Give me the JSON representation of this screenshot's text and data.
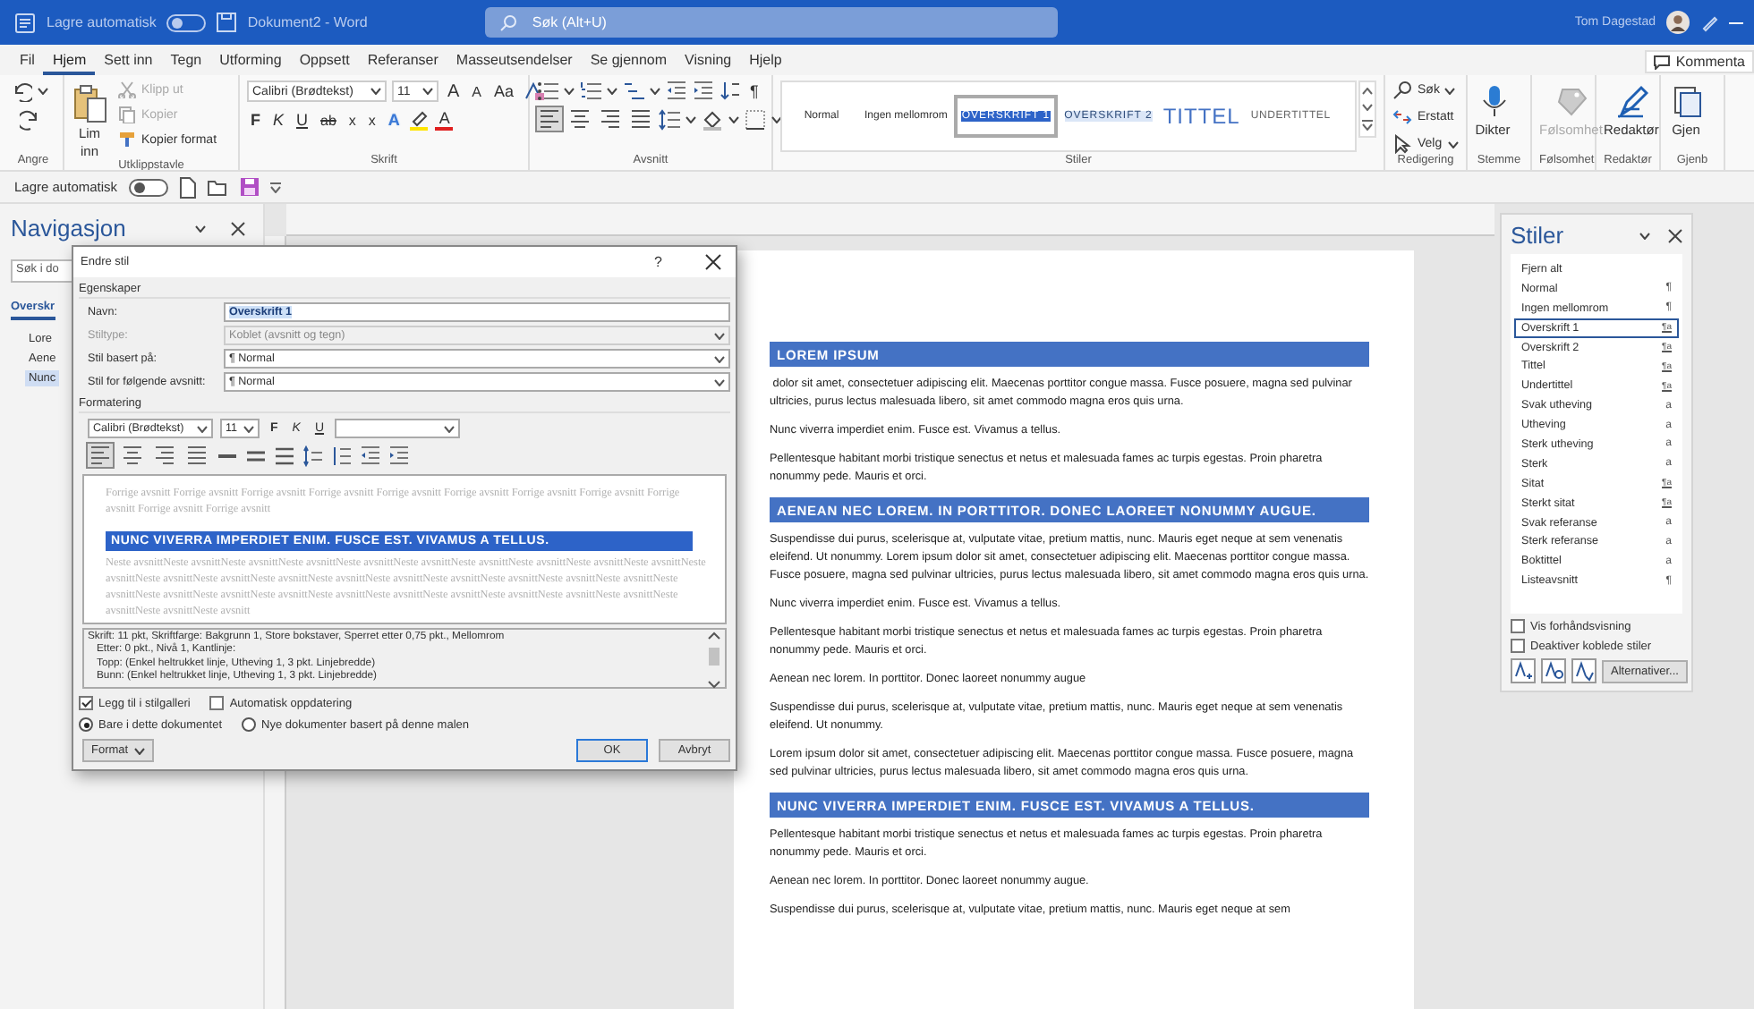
{
  "titlebar": {
    "autosave_label": "Lagre automatisk",
    "autosave_on": false,
    "document_title": "Dokument2  -  Word",
    "search_placeholder": "Søk (Alt+U)",
    "user_name": "Tom Dagestad"
  },
  "menu_tabs": [
    {
      "label": "Fil",
      "selected": false
    },
    {
      "label": "Hjem",
      "selected": true
    },
    {
      "label": "Sett inn",
      "selected": false
    },
    {
      "label": "Tegn",
      "selected": false
    },
    {
      "label": "Utforming",
      "selected": false
    },
    {
      "label": "Oppsett",
      "selected": false
    },
    {
      "label": "Referanser",
      "selected": false
    },
    {
      "label": "Masseutsendelser",
      "selected": false
    },
    {
      "label": "Se gjennom",
      "selected": false
    },
    {
      "label": "Visning",
      "selected": false
    },
    {
      "label": "Hjelp",
      "selected": false
    }
  ],
  "comments_button": "Kommenta",
  "ribbon": {
    "groups": [
      {
        "kind": "undo",
        "label": "Angre"
      },
      {
        "kind": "clipboard",
        "label": "Utklippstavle",
        "paste": [
          "Lim",
          "inn"
        ],
        "items": [
          {
            "label": "Klipp ut",
            "disabled": true
          },
          {
            "label": "Kopier",
            "disabled": true
          },
          {
            "label": "Kopier format",
            "disabled": false
          }
        ]
      },
      {
        "kind": "font",
        "label": "Skrift",
        "font": "Calibri (Brødtekst)",
        "size": "11",
        "row1": [
          {
            "label": "A",
            "kind": "grow"
          },
          {
            "label": "A",
            "kind": "shrink"
          },
          {
            "label": "Aa",
            "kind": "case"
          }
        ],
        "row2": [
          {
            "label": "F",
            "kind": "bold"
          },
          {
            "label": "K",
            "kind": "italic"
          },
          {
            "label": "U",
            "kind": "underline"
          },
          {
            "label": "ab",
            "kind": "strike"
          },
          {
            "label": "x",
            "kind": "sub"
          },
          {
            "label": "x",
            "kind": "sup"
          },
          {
            "label": "A",
            "kind": "effects"
          },
          {
            "label": "A",
            "kind": "color"
          }
        ]
      },
      {
        "kind": "paragraph",
        "label": "Avsnitt",
        "marks": "¶",
        "align": [
          {
            "selected": true
          },
          {
            "selected": false
          },
          {
            "selected": false
          },
          {
            "selected": false
          }
        ]
      },
      {
        "kind": "styles",
        "label": "Stiler",
        "items": [
          {
            "label": "Normal",
            "kind": "normal",
            "selected": false
          },
          {
            "label": "Ingen mellomrom",
            "kind": "nospacing",
            "selected": false
          },
          {
            "label": "OVERSKRIFT 1",
            "kind": "heading1",
            "selected": true
          },
          {
            "label": "OVERSKRIFT 2",
            "kind": "heading2",
            "selected": false
          },
          {
            "label": "TITTEL",
            "kind": "title",
            "selected": false
          },
          {
            "label": "UNDERTITTEL",
            "kind": "subtitle",
            "selected": false
          }
        ]
      },
      {
        "kind": "editing",
        "label": "Redigering",
        "items": [
          "Søk",
          "Erstatt",
          "Velg"
        ]
      },
      {
        "kind": "big",
        "label": "Stemme",
        "button": "Dikter",
        "disabled": false
      },
      {
        "kind": "big",
        "label": "Følsomhet",
        "button": "Følsomhet",
        "disabled": true
      },
      {
        "kind": "big",
        "label": "Redaktør",
        "button": "Redaktør",
        "disabled": false
      },
      {
        "kind": "big",
        "label": "Gjenb",
        "button": "Gjen",
        "disabled": false
      }
    ]
  },
  "quick_access": {
    "autosave_label": "Lagre automatisk",
    "autosave_on": false
  },
  "navigation": {
    "title": "Navigasjon",
    "search": "Søk i do",
    "tab": "Overskr",
    "items": [
      {
        "label": "Lore",
        "selected": false
      },
      {
        "label": "Aene",
        "selected": false
      },
      {
        "label": "Nunc",
        "selected": true
      }
    ]
  },
  "document": {
    "paragraphs": [
      {
        "kind": "heading",
        "text": "LOREM IPSUM"
      },
      {
        "kind": "body",
        "text": " dolor sit amet, consectetuer adipiscing elit. Maecenas porttitor congue massa. Fusce posuere, magna sed pulvinar ultricies, purus lectus malesuada libero, sit amet commodo magna eros quis urna."
      },
      {
        "kind": "body",
        "text": "Nunc viverra imperdiet enim. Fusce est. Vivamus a tellus."
      },
      {
        "kind": "body",
        "text": "Pellentesque habitant morbi tristique senectus et netus et malesuada fames ac turpis egestas. Proin pharetra nonummy pede. Mauris et orci."
      },
      {
        "kind": "heading",
        "text": "AENEAN NEC LOREM. IN PORTTITOR. DONEC LAOREET NONUMMY AUGUE."
      },
      {
        "kind": "body",
        "text": "Suspendisse dui purus, scelerisque at, vulputate vitae, pretium mattis, nunc. Mauris eget neque at sem venenatis eleifend. Ut nonummy. Lorem ipsum dolor sit amet, consectetuer adipiscing elit. Maecenas porttitor congue massa. Fusce posuere, magna sed pulvinar ultricies, purus lectus malesuada libero, sit amet commodo magna eros quis urna."
      },
      {
        "kind": "body",
        "text": "Nunc viverra imperdiet enim. Fusce est. Vivamus a tellus."
      },
      {
        "kind": "body",
        "text": "Pellentesque habitant morbi tristique senectus et netus et malesuada fames ac turpis egestas. Proin pharetra nonummy pede. Mauris et orci."
      },
      {
        "kind": "body",
        "text": "Aenean nec lorem. In porttitor. Donec laoreet nonummy augue"
      },
      {
        "kind": "body",
        "text": "Suspendisse dui purus, scelerisque at, vulputate vitae, pretium mattis, nunc. Mauris eget neque at sem venenatis eleifend. Ut nonummy."
      },
      {
        "kind": "body",
        "text": "Lorem ipsum dolor sit amet, consectetuer adipiscing elit. Maecenas porttitor congue massa. Fusce posuere, magna sed pulvinar ultricies, purus lectus malesuada libero, sit amet commodo magna eros quis urna."
      },
      {
        "kind": "heading",
        "text": "NUNC VIVERRA IMPERDIET ENIM. FUSCE EST. VIVAMUS A TELLUS."
      },
      {
        "kind": "body",
        "text": "Pellentesque habitant morbi tristique senectus et netus et malesuada fames ac turpis egestas. Proin pharetra nonummy pede. Mauris et orci."
      },
      {
        "kind": "body",
        "text": "Aenean nec lorem. In porttitor. Donec laoreet nonummy augue."
      },
      {
        "kind": "body",
        "text": "Suspendisse dui purus, scelerisque at, vulputate vitae, pretium mattis, nunc. Mauris eget neque at sem"
      }
    ]
  },
  "styles_pane": {
    "title": "Stiler",
    "items": [
      {
        "label": "Fjern alt",
        "marker": null,
        "selected": false
      },
      {
        "label": "Normal",
        "marker": "¶",
        "selected": false
      },
      {
        "label": "Ingen mellomrom",
        "marker": "¶",
        "selected": false
      },
      {
        "label": "Overskrift 1",
        "marker": "¶a",
        "selected": true
      },
      {
        "label": "Overskrift 2",
        "marker": "¶a",
        "selected": false
      },
      {
        "label": "Tittel",
        "marker": "¶a",
        "selected": false
      },
      {
        "label": "Undertittel",
        "marker": "¶a",
        "selected": false
      },
      {
        "label": "Svak utheving",
        "marker": "a",
        "selected": false
      },
      {
        "label": "Utheving",
        "marker": "a",
        "selected": false
      },
      {
        "label": "Sterk utheving",
        "marker": "a",
        "selected": false
      },
      {
        "label": "Sterk",
        "marker": "a",
        "selected": false
      },
      {
        "label": "Sitat",
        "marker": "¶a",
        "selected": false
      },
      {
        "label": "Sterkt sitat",
        "marker": "¶a",
        "selected": false
      },
      {
        "label": "Svak referanse",
        "marker": "a",
        "selected": false
      },
      {
        "label": "Sterk referanse",
        "marker": "a",
        "selected": false
      },
      {
        "label": "Boktittel",
        "marker": "a",
        "selected": false
      },
      {
        "label": "Listeavsnitt",
        "marker": "¶",
        "selected": false
      }
    ],
    "options": [
      {
        "label": "Vis forhåndsvisning",
        "checked": false
      },
      {
        "label": "Deaktiver koblede stiler",
        "checked": false
      }
    ],
    "button": "Alternativer..."
  },
  "dialog": {
    "title": "Endre stil",
    "help": "?",
    "section_properties": "Egenskaper",
    "fields": [
      {
        "label": "Navn:",
        "value": "Overskrift 1",
        "kind": "text",
        "disabled": false
      },
      {
        "label": "Stiltype:",
        "value": "Koblet (avsnitt og tegn)",
        "kind": "select",
        "disabled": true
      },
      {
        "label": "Stil basert på:",
        "value": "¶  Normal",
        "kind": "select",
        "disabled": false
      },
      {
        "label": "Stil for følgende avsnitt:",
        "value": "¶  Normal",
        "kind": "select",
        "disabled": false
      }
    ],
    "section_formatting": "Formatering",
    "font": "Calibri (Brødtekst)",
    "size": "11",
    "format_buttons": [
      "F",
      "K",
      "U"
    ],
    "align": [
      {
        "selected": true
      },
      {
        "selected": false
      },
      {
        "selected": false
      },
      {
        "selected": false
      }
    ],
    "preview_before": "Forrige avsnitt Forrige avsnitt Forrige avsnitt Forrige avsnitt Forrige avsnitt Forrige avsnitt Forrige avsnitt Forrige avsnitt Forrige avsnitt Forrige avsnitt Forrige avsnitt",
    "preview_heading": "NUNC VIVERRA IMPERDIET ENIM. FUSCE EST. VIVAMUS A TELLUS.",
    "preview_after": "Neste avsnittNeste avsnittNeste avsnittNeste avsnittNeste avsnittNeste avsnittNeste avsnittNeste avsnittNeste avsnittNeste avsnittNeste avsnittNeste avsnittNeste avsnittNeste avsnittNeste avsnittNeste avsnittNeste avsnittNeste avsnittNeste avsnittNeste avsnittNeste avsnittNeste avsnittNeste avsnittNeste avsnittNeste avsnittNeste avsnittNeste avsnittNeste avsnittNeste avsnittNeste avsnittNeste avsnittNeste avsnittNeste avsnitt",
    "description": [
      "Skrift: 11 pkt, Skriftfarge: Bakgrunn 1, Store bokstaver, Sperret etter  0,75 pkt., Mellomrom",
      "Etter:  0 pkt., Nivå 1, Kantlinje:",
      "Topp: (Enkel heltrukket linje, Utheving 1,  3 pkt. Linjebredde)",
      "Bunn: (Enkel heltrukket linje, Utheving 1,  3 pkt. Linjebredde)"
    ],
    "checkboxes": [
      {
        "label": "Legg til i stilgalleri",
        "checked": true
      },
      {
        "label": "Automatisk oppdatering",
        "checked": false
      }
    ],
    "radios": [
      {
        "label": "Bare i dette dokumentet",
        "selected": true
      },
      {
        "label": "Nye dokumenter basert på denne malen",
        "selected": false
      }
    ],
    "format_button": "Format",
    "ok": "OK",
    "cancel": "Avbryt"
  }
}
